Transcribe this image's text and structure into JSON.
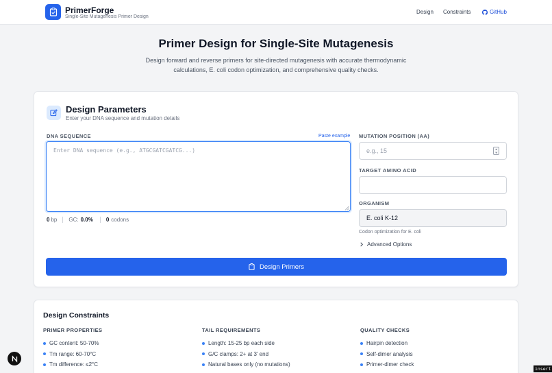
{
  "header": {
    "brand": "PrimerForge",
    "tagline": "Single-Site Mutagenesis Primer Design",
    "nav": [
      "Design",
      "Constraints",
      "GitHub"
    ]
  },
  "hero": {
    "title": "Primer Design for Single-Site Mutagenesis",
    "subtitle_line1": "Design forward and reverse primers for site-directed mutagenesis with accurate thermodynamic",
    "subtitle_line2": "calculations, E. coli codon optimization, and comprehensive quality checks."
  },
  "params": {
    "title": "Design Parameters",
    "subtitle": "Enter your DNA sequence and mutation details",
    "dna_label": "DNA SEQUENCE",
    "paste_example": "Paste example",
    "dna_placeholder": "Enter DNA sequence (e.g., ATGCGATCGATCG...)",
    "dna_value": "",
    "stats": {
      "bp_value": "0",
      "bp_unit": "bp",
      "gc_label": "GC:",
      "gc_value": "0.0%",
      "codons_value": "0",
      "codons_unit": "codons"
    },
    "mutation_label": "MUTATION POSITION (AA)",
    "mutation_placeholder": "e.g., 15",
    "target_label": "TARGET AMINO ACID",
    "target_placeholder": "",
    "organism_label": "ORGANISM",
    "organism_value": "E. coli K-12",
    "organism_helper": "Codon optimization for E. coli",
    "advanced": "Advanced Options",
    "submit": "Design Primers"
  },
  "constraints": {
    "title": "Design Constraints",
    "columns": [
      {
        "heading": "PRIMER PROPERTIES",
        "items": [
          "GC content: 50-70%",
          "Tm range: 60-70°C",
          "Tm difference: ≤2°C"
        ]
      },
      {
        "heading": "TAIL REQUIREMENTS",
        "items": [
          "Length: 15-25 bp each side",
          "G/C clamps: 2+ at 3' end",
          "Natural bases only (no mutations)"
        ]
      },
      {
        "heading": "QUALITY CHECKS",
        "items": [
          "Hairpin detection",
          "Self-dimer analysis",
          "Primer-dimer check"
        ]
      }
    ]
  },
  "overlay": {
    "badge": "N",
    "insert": "insert"
  },
  "colors": {
    "accent": "#2563eb",
    "accent_light": "#dbeafe",
    "background": "#f3f4f6"
  }
}
